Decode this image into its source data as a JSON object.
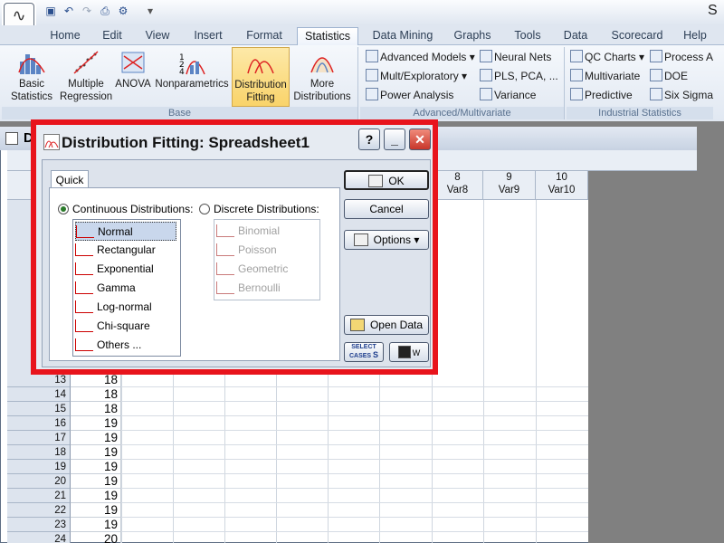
{
  "window": {
    "title_fragment": "S"
  },
  "quick_access": {
    "icons": [
      "save-icon",
      "undo-icon",
      "redo-icon",
      "print-icon",
      "settings-icon"
    ]
  },
  "tabs": [
    "Home",
    "Edit",
    "View",
    "Insert",
    "Format",
    "Statistics",
    "Data Mining",
    "Graphs",
    "Tools",
    "Data",
    "Scorecard",
    "Help"
  ],
  "active_tab": "Statistics",
  "ribbon": {
    "base": {
      "label": "Base",
      "buttons": [
        {
          "label1": "Basic",
          "label2": "Statistics"
        },
        {
          "label1": "Multiple",
          "label2": "Regression"
        },
        {
          "label1": "ANOVA",
          "label2": ""
        },
        {
          "label1": "Nonparametrics",
          "label2": ""
        },
        {
          "label1": "Distribution",
          "label2": "Fitting"
        },
        {
          "label1": "More",
          "label2": "Distributions"
        }
      ]
    },
    "advanced": {
      "label": "Advanced/Multivariate",
      "items": [
        "Advanced Models ▾",
        "Neural Nets",
        "Mult/Exploratory ▾",
        "PLS, PCA, ...",
        "Power Analysis",
        "Variance"
      ]
    },
    "industrial": {
      "label": "Industrial Statistics",
      "items": [
        "QC Charts ▾",
        "Process A",
        "Multivariate",
        "DOE",
        "Predictive",
        "Six Sigma"
      ]
    }
  },
  "spreadsheet": {
    "title_fragment": "D",
    "columns": [
      {
        "num": "8",
        "name": "Var8"
      },
      {
        "num": "9",
        "name": "Var9"
      },
      {
        "num": "10",
        "name": "Var10"
      }
    ],
    "rows": [
      {
        "n": "13",
        "v": "18"
      },
      {
        "n": "14",
        "v": "18"
      },
      {
        "n": "15",
        "v": "18"
      },
      {
        "n": "16",
        "v": "19"
      },
      {
        "n": "17",
        "v": "19"
      },
      {
        "n": "18",
        "v": "19"
      },
      {
        "n": "19",
        "v": "19"
      },
      {
        "n": "20",
        "v": "19"
      },
      {
        "n": "21",
        "v": "19"
      },
      {
        "n": "22",
        "v": "19"
      },
      {
        "n": "23",
        "v": "19"
      },
      {
        "n": "24",
        "v": "20"
      }
    ]
  },
  "dialog": {
    "title": "Distribution Fitting: Spreadsheet1",
    "help": "?",
    "minimize": "_",
    "close": "✕",
    "tab": "Quick",
    "continuous_label": "Continuous Distributions:",
    "discrete_label": "Discrete Distributions:",
    "continuous": [
      "Normal",
      "Rectangular",
      "Exponential",
      "Gamma",
      "Log-normal",
      "Chi-square",
      "Others ..."
    ],
    "selected": "Normal",
    "discrete": [
      "Binomial",
      "Poisson",
      "Geometric",
      "Bernoulli"
    ],
    "ok": "OK",
    "cancel": "Cancel",
    "options": "Options",
    "open_data": "Open Data",
    "select_cases": "SELECT CASES",
    "select_cases_key": "S",
    "weight_key": "W"
  },
  "colors": {
    "highlight_border": "#e8141c",
    "ribbon_selected": "#f9d36a"
  }
}
